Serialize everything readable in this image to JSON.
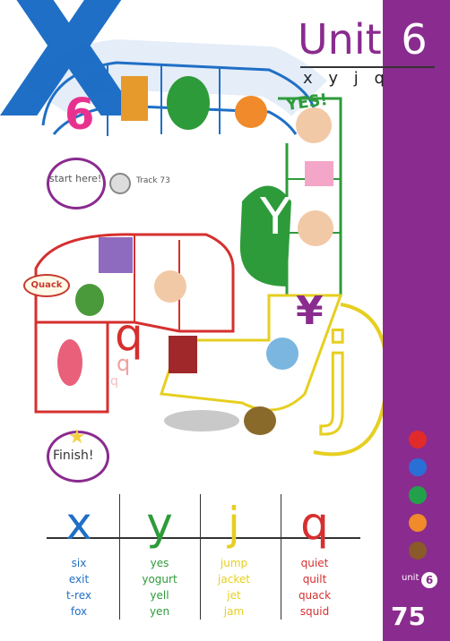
{
  "header": {
    "unit_label": "Unit",
    "unit_number": "6",
    "letters": "x y j q"
  },
  "decor": {
    "big_letter": "X",
    "path_number": "6",
    "y_label": "Y",
    "yen_symbol": "¥",
    "j_label": "j",
    "q_label": "q"
  },
  "start": {
    "label": "start here!",
    "track": "Track 73"
  },
  "finish": {
    "label": "Finish!"
  },
  "speech": {
    "quack": "Quack",
    "yes": "YES!"
  },
  "word_table": {
    "columns": [
      {
        "letter": "x",
        "color": "#1f6fc6",
        "words": [
          "six",
          "exit",
          "t-rex",
          "fox"
        ]
      },
      {
        "letter": "y",
        "color": "#2e9b3b",
        "words": [
          "yes",
          "yogurt",
          "yell",
          "yen"
        ]
      },
      {
        "letter": "j",
        "color": "#e6cf20",
        "words": [
          "jump",
          "jacket",
          "jet",
          "jam"
        ]
      },
      {
        "letter": "q",
        "color": "#d62f2f",
        "words": [
          "quiet",
          "quilt",
          "quack",
          "squid"
        ]
      }
    ]
  },
  "sidebar": {
    "dot_colors": [
      "#e12a2a",
      "#2a6fd6",
      "#23a14a",
      "#f08a2a",
      "#8a5a2b"
    ],
    "unit_small": "unit",
    "unit_small_num": "6",
    "page_number": "75"
  }
}
